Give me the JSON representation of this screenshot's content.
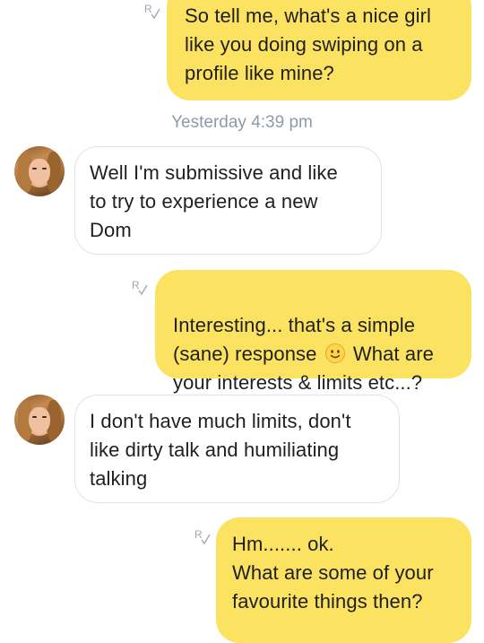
{
  "conversation": {
    "messages": [
      {
        "direction": "sent",
        "text": "So tell me, what's a nice girl\nlike you doing swiping on a\nprofile like mine?",
        "read_receipt": "R"
      },
      {
        "direction": "received",
        "text": "Well I'm submissive and like\nto try to experience a new\nDom"
      },
      {
        "direction": "sent",
        "text_before_emoji": "Interesting... that's a simple\n(sane) response ",
        "emoji": "slightly-smiling-face",
        "text_after_emoji": " What are\nyour interests & limits etc...?",
        "read_receipt": "R"
      },
      {
        "direction": "received",
        "text": "I don't have much limits, don't\nlike dirty talk and humiliating\ntalking"
      },
      {
        "direction": "sent",
        "text": "Hm....... ok.\nWhat are some of your\nfavourite things then?",
        "read_receipt": "R"
      }
    ],
    "timestamp": "Yesterday 4:39 pm"
  },
  "colors": {
    "sent_bubble": "#fbe261",
    "received_border": "#e2e2e2",
    "timestamp_text": "#8e9aa8",
    "receipt_icon": "#a0a8b4"
  }
}
